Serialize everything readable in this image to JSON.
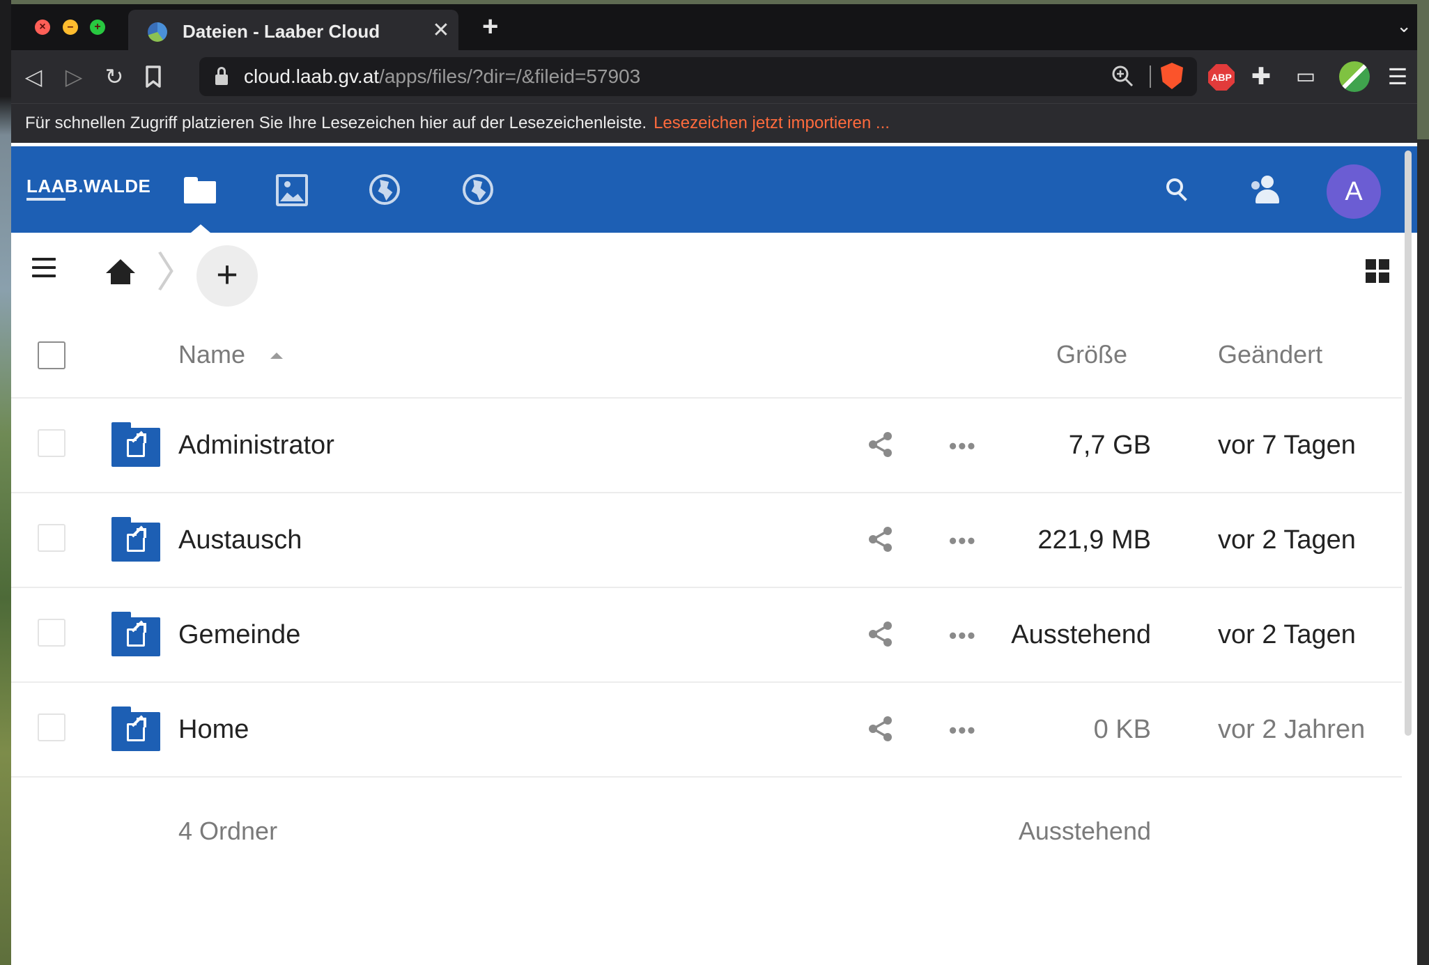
{
  "browser": {
    "tab_title": "Dateien - Laaber Cloud",
    "tab_close": "✕",
    "new_tab": "+",
    "tab_menu": "⌄",
    "url_host": "cloud.laab.gv.at",
    "url_path": "/apps/files/?dir=/&fileid=57903",
    "abp_label": "ABP",
    "bookmark_hint": "Für schnellen Zugriff platzieren Sie Ihre Lesezeichen hier auf der Lesezeichenleiste.",
    "bookmark_link": "Lesezeichen jetzt importieren ..."
  },
  "header": {
    "logo_text": "LAAB.WALDE",
    "avatar_initial": "A",
    "brand_color": "#1d5fb4",
    "avatar_color": "#6b5dd3"
  },
  "controls": {
    "new_label": "+"
  },
  "list": {
    "columns": {
      "name": "Name",
      "size": "Größe",
      "modified": "Geändert"
    },
    "rows": [
      {
        "name": "Administrator",
        "size": "7,7 GB",
        "modified": "vor 7 Tagen"
      },
      {
        "name": "Austausch",
        "size": "221,9 MB",
        "modified": "vor 2 Tagen"
      },
      {
        "name": "Gemeinde",
        "size": "Ausstehend",
        "modified": "vor 2 Tagen"
      },
      {
        "name": "Home",
        "size": "0 KB",
        "modified": "vor 2 Jahren"
      }
    ],
    "more_label": "•••",
    "summary": {
      "count": "4 Ordner",
      "size": "Ausstehend"
    }
  }
}
